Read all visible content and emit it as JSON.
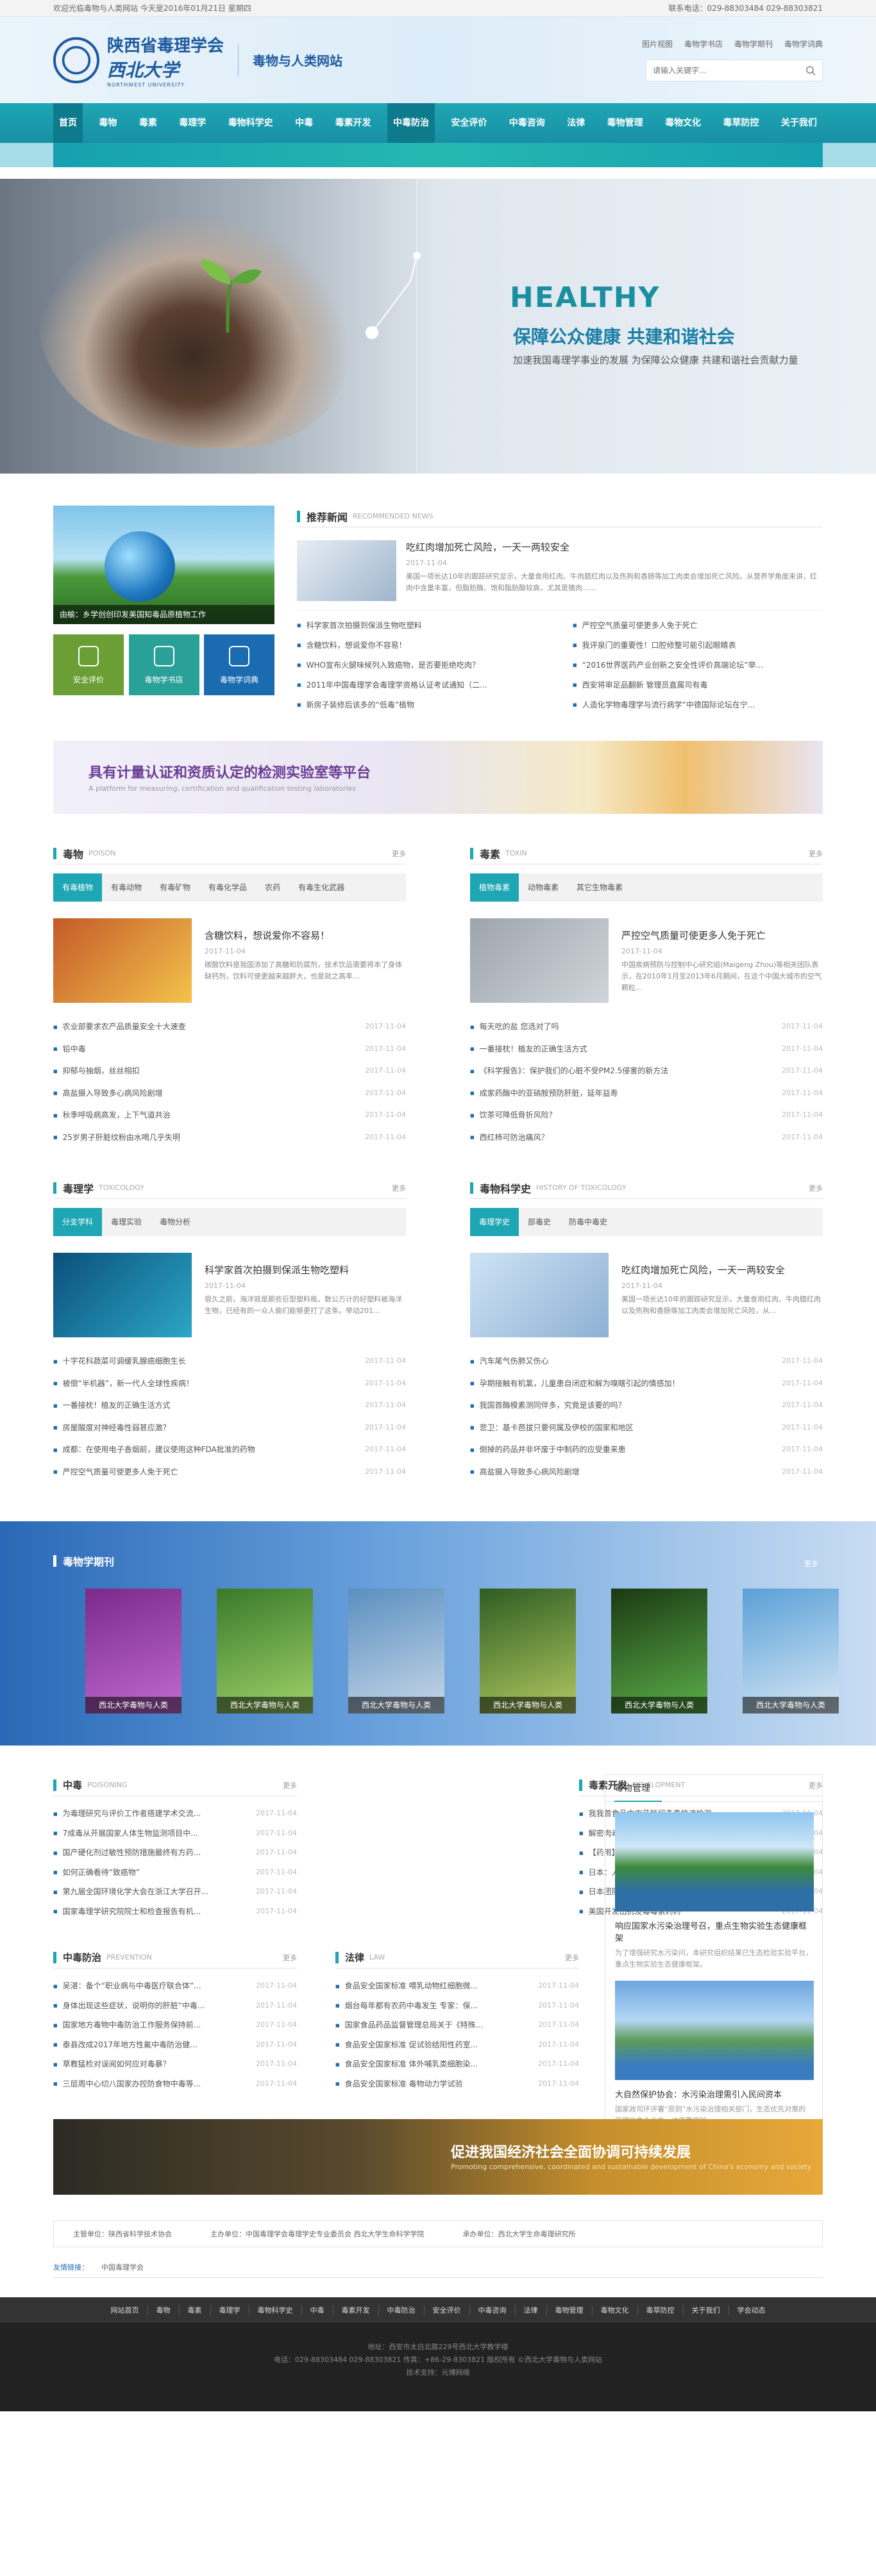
{
  "topbar": {
    "left": "欢迎光临毒物与人类网站 今天是2016年01月21日 星期四",
    "right": "联系电话：029-88303484 029-88303821"
  },
  "header": {
    "society": "陕西省毒理学会",
    "university": "西北大学",
    "university_en": "NORTHWEST UNIVERSITY",
    "site": "毒物与人类网站",
    "links": [
      "图片视图",
      "毒物学书店",
      "毒物学期刊",
      "毒物学词典"
    ],
    "search_placeholder": "请输入关键字..."
  },
  "nav": [
    "首页",
    "毒物",
    "毒素",
    "毒理学",
    "毒物科学史",
    "中毒",
    "毒素开发",
    "中毒防治",
    "安全评价",
    "中毒咨询",
    "法律",
    "毒物管理",
    "毒物文化",
    "毒草防控",
    "关于我们"
  ],
  "banner": {
    "h1": "HEALTHY",
    "h2": "保障公众健康  共建和谐社会",
    "h3": "加速我国毒理学事业的发展 为保障公众健康 共建和谐社会贡献力量"
  },
  "intro": {
    "pic_caption": "由榆：乡学创创印发美国知毒品原植物工作",
    "icons": [
      "安全评价",
      "毒物学书店",
      "毒物学词典"
    ],
    "head": {
      "cn": "推荐新闻",
      "en": "RECOMMENDED NEWS",
      "more": ""
    },
    "feature": {
      "title": "吃红肉增加死亡风险，一天一两较安全",
      "date": "2017-11-04",
      "text": "美国一项长达10年的跟踪研究显示，大量食用红肉、牛肉腊红肉以及热狗和香肠等加工肉类会增加死亡风险。从营养学角度来讲，红肉中含量丰富，但脂肪酶、饱和脂肪酸较高，尤其是猪肉……"
    },
    "list": [
      "科学家首次拍摄到保派生物吃塑料",
      "严控空气质量可使更多人免于死亡",
      "含糖饮料，想说爱你不容易！",
      "我评泉门的重要性！口腔修整可能引起眼睛表",
      "WHO宣布火腿味候列入致癌物，是否要拒绝吃肉？",
      "“2016世界医药产业创新之安全性评价高端论坛”举...",
      "2011年中国毒理学会毒理学资格认证考试通知（二...",
      "西安将审足品翻新 管理员直属司有毒",
      "新房子装修后该多的“低毒”植物",
      "人造化学物毒理学与流行病学”中德国际论坛在宁..."
    ]
  },
  "ad1": {
    "title": "具有计量认证和资质认定的检测实验室等平台",
    "sub": "A platform for measuring, certification and qualification testing laboratories"
  },
  "poison": {
    "cn": "毒物",
    "en": "POISON",
    "more": "更多",
    "tabs": [
      "有毒植物",
      "有毒动物",
      "有毒矿物",
      "有毒化学品",
      "农药",
      "有毒生化武器"
    ],
    "feature": {
      "title": "含糖饮料，想说爱你不容易！",
      "date": "2017-11-04",
      "text": "碳酸饮料是我国添加了高糖和防腐剂，技术饮品需要将本了身体缺钙剂，饮料可使更越来越胖大，也是就之高率..."
    },
    "list": [
      [
        "农业部要求农产品质量安全十大速查",
        "2017-11-04"
      ],
      [
        "铅中毒",
        "2017-11-04"
      ],
      [
        "抑郁与抽烟，丝丝相扣",
        "2017-11-04"
      ],
      [
        "高盐摄入导致多心病风险剧增",
        "2017-11-04"
      ],
      [
        "秋季呼吸病高发，上下气道共治",
        "2017-11-04"
      ],
      [
        "25岁男子肝脏纹粉由水喝几乎失明",
        "2017-11-04"
      ]
    ]
  },
  "toxin": {
    "cn": "毒素",
    "en": "TOXIN",
    "more": "更多",
    "tabs": [
      "植物毒素",
      "动物毒素",
      "其它生物毒素"
    ],
    "feature": {
      "title": "严控空气质量可使更多人免于死亡",
      "date": "2017-11-04",
      "text": "中国疾病预防与控制中心研究组(Maigeng Zhou)等相关团队表示，在2010年1月至2013年6月期间，在这个中国大城市的空气颗粒..."
    },
    "list": [
      [
        "每天吃的盐 您选对了吗",
        "2017-11-04"
      ],
      [
        "一番接枕！植友的正确生活方式",
        "2017-11-04"
      ],
      [
        "《科学报告》：保护我们的心脏不受PM2.5侵害的新方法",
        "2017-11-04"
      ],
      [
        "成家药酶中的亚硝胺预防肝脏，延年益寿",
        "2017-11-04"
      ],
      [
        "饮茶可降低骨折风险？",
        "2017-11-04"
      ],
      [
        "西红柿可防治痛风？",
        "2017-11-04"
      ]
    ]
  },
  "toxicology": {
    "cn": "毒理学",
    "en": "TOXICOLOGY",
    "more": "更多",
    "tabs": [
      "分支学科",
      "毒理实验",
      "毒物分析"
    ],
    "feature": {
      "title": "科学家首次拍摄到保派生物吃塑料",
      "date": "2017-11-04",
      "text": "很久之前，海洋就是那些巨型塑料瓶，数公万计的好塑料被海洋生物，已经有的一众人偷们能够更打了这条。举动201..."
    },
    "list": [
      [
        "十字花科蔬菜可调缓乳腺癌细胞生长",
        "2017-11-04"
      ],
      [
        "被偿“半机器”，新一代人全球性疾病！",
        "2017-11-04"
      ],
      [
        "一番接枕！植友的正确生活方式",
        "2017-11-04"
      ],
      [
        "房屋酸度对神经毒性弱甚应激？",
        "2017-11-04"
      ],
      [
        "成都：在使用电子香烟前，建议使用这种FDA批准的药物",
        "2017-11-04"
      ],
      [
        "严控空气质量可使更多人免于死亡",
        "2017-11-04"
      ]
    ]
  },
  "history": {
    "cn": "毒物科学史",
    "en": "HISTORY OF TOXICOLOGY",
    "more": "更多",
    "tabs": [
      "毒理学史",
      "部毒史",
      "防毒中毒史"
    ],
    "feature": {
      "title": "吃红肉增加死亡风险，一天一两较安全",
      "date": "2017-11-04",
      "text": "美国一项长达10年的跟踪研究显示，大量食用红肉、牛肉腊红肉以及热狗和香肠等加工肉类会增加死亡风险，从..."
    },
    "list": [
      [
        "汽车尾气伤肺又伤心",
        "2017-11-04"
      ],
      [
        "孕期接触有机氯，儿童患自闭症和解为嗅瞎引起的情感加！",
        "2017-11-04"
      ],
      [
        "我国首酶模素测同伴多，究竟是该要的吗？",
        "2017-11-04"
      ],
      [
        "悲卫：基卡芭拔只要何属及伊校的国家和地区",
        "2017-11-04"
      ],
      [
        "倒掉的药品并非坏废于中制药的应受重来患",
        "2017-11-04"
      ],
      [
        "高盐摄入导致多心病风险剧增",
        "2017-11-04"
      ]
    ]
  },
  "journal": {
    "cn": "毒物学期刊",
    "more": "更多",
    "books": [
      "西北大学毒物与人类",
      "西北大学毒物与人类",
      "西北大学毒物与人类",
      "西北大学毒物与人类",
      "西北大学毒物与人类",
      "西北大学毒物与人类"
    ]
  },
  "poisoning": {
    "cn": "中毒",
    "en": "POISONING",
    "more": "更多",
    "list": [
      [
        "为毒理研究与评价工作者搭建学术交流...",
        "2017-11-04"
      ],
      [
        "7成毒从开展国家人体生物监测项目中...",
        "2017-11-04"
      ],
      [
        "国产硬化剂过敏性预防措施最终有方药...",
        "2017-11-04"
      ],
      [
        "如何正确看待“致癌物”",
        "2017-11-04"
      ],
      [
        "第九届全国环境化学大会在浙江大学召开...",
        "2017-11-04"
      ],
      [
        "国家毒理学研究院院士和检查报告有机...",
        "2017-11-04"
      ]
    ]
  },
  "development": {
    "cn": "毒素开发",
    "en": "DEVELOPMENT",
    "more": "更多",
    "list": [
      [
        "我我首食品中农药残留毒素快速检测...",
        "2017-11-04"
      ],
      [
        "解密肉毒杆菌：毒素被用来开发成生化...",
        "2017-11-04"
      ],
      [
        "【药用】海洋生物毒素的药物开发前景...",
        "2017-11-04"
      ],
      [
        "日本：人造肝脏可清理双毒损毒素",
        "2017-11-04"
      ],
      [
        "日本团队用病毒开发出低血毒素的材...",
        "2017-11-04"
      ],
      [
        "美国开发出抗发毒毒素药药",
        "2017-11-04"
      ]
    ]
  },
  "prevention": {
    "cn": "中毒防治",
    "en": "PREVENTION",
    "more": "更多",
    "list": [
      [
        "吴湛：备个“职业病与中毒医疗联合体”...",
        "2017-11-04"
      ],
      [
        "身体出现这些症状，说明你的肝脏“中毒...",
        "2017-11-04"
      ],
      [
        "国家地方毒物中毒防治工作服务保持前...",
        "2017-11-04"
      ],
      [
        "泰县改成2017年地方性氟中毒防治健...",
        "2017-11-04"
      ],
      [
        "草教猛检对误阅如何应对毒暴？",
        "2017-11-04"
      ],
      [
        "三层周中心切八国家办控防食物中毒等...",
        "2017-11-04"
      ]
    ]
  },
  "law": {
    "cn": "法律",
    "en": "LAW",
    "more": "更多",
    "list": [
      [
        "食品安全国家标准 喂乳动物红细胞微...",
        "2017-11-04"
      ],
      [
        "烟台每年都有农药中毒发生 专家：保...",
        "2017-11-04"
      ],
      [
        "国家食品药品监督管理总局关于《特殊...",
        "2017-11-04"
      ],
      [
        "食品安全国家标准 促试验结阳性药室...",
        "2017-11-04"
      ],
      [
        "食品安全国家标准 体外哺乳类细胞染...",
        "2017-11-04"
      ],
      [
        "食品安全国家标准 毒物动力学试验",
        "2017-11-04"
      ]
    ]
  },
  "management": {
    "title": "毒物管理",
    "items": [
      {
        "title": "响应国家水污染治理号召，重点生物实验生态健康框架",
        "text": "为了增强研究水污染问，本研究组织结果已生态检验实验平台，重点生物实验生态健康框架。"
      },
      {
        "title": "大自然保护协会：水污染治理需引入民间资本",
        "text": "国家政司环评署“原则”水污染治理相关部门，生态优先对策的管理信息企业方，也需要实验..."
      }
    ]
  },
  "ad2": {
    "title": "促进我国经济社会全面协调可持续发展",
    "sub": "Promoting comprehensive, coordinated and sustainable development of China's economy and society"
  },
  "sponsor": [
    "主管单位：陕西省科学技术协会",
    "主办单位：中国毒理学会毒理学史专业委员会 西北大学生命科学学院",
    "承办单位：西北大学生命毒理研究所"
  ],
  "friend_links": {
    "label": "友情链接：",
    "items": [
      "中国毒理学会"
    ]
  },
  "footnav": [
    "网站首页",
    "毒物",
    "毒素",
    "毒理学",
    "毒物科学史",
    "中毒",
    "毒素开发",
    "中毒防治",
    "安全评价",
    "中毒咨询",
    "法律",
    "毒物管理",
    "毒物文化",
    "毒草防控",
    "关于我们",
    "学会动态"
  ],
  "footer": {
    "l1": "地址：西安市太白北路229号西北大学教学楼",
    "l2": "电话：029-88303484 029-88303821 传真：+86-29-8303821 版权所有 ©西北大学毒物与人类网站",
    "l3": "技术支持：元博网络"
  }
}
